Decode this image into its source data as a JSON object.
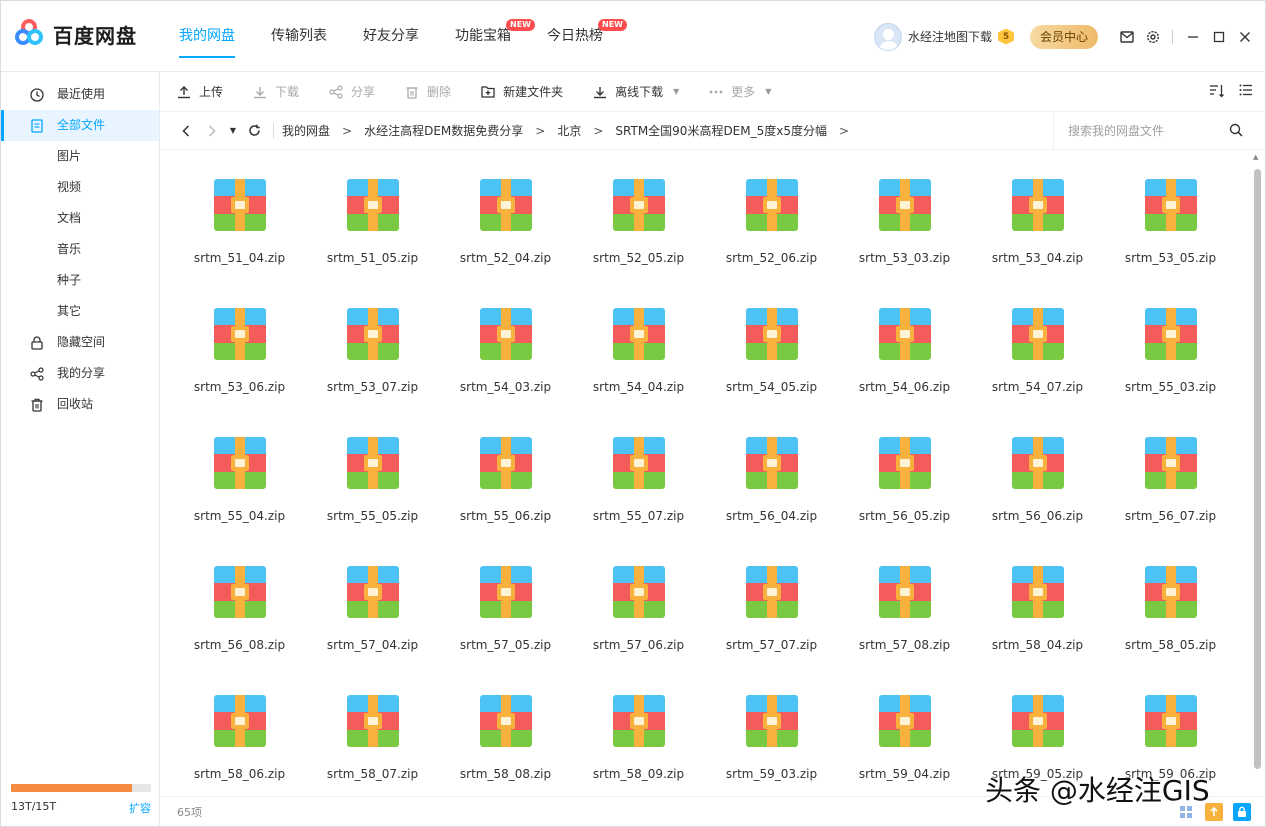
{
  "app": {
    "name": "百度网盘"
  },
  "main_nav": [
    {
      "label": "我的网盘",
      "active": true,
      "badge": ""
    },
    {
      "label": "传输列表",
      "active": false,
      "badge": ""
    },
    {
      "label": "好友分享",
      "active": false,
      "badge": ""
    },
    {
      "label": "功能宝箱",
      "active": false,
      "badge": "NEW"
    },
    {
      "label": "今日热榜",
      "active": false,
      "badge": "NEW"
    }
  ],
  "user": {
    "name": "水经注地图下载",
    "level": "5",
    "vip_label": "会员中心"
  },
  "sidebar": {
    "items": [
      {
        "label": "最近使用",
        "icon": "clock-icon",
        "active": false
      },
      {
        "label": "全部文件",
        "icon": "file-icon",
        "active": true
      },
      {
        "label": "图片",
        "icon": "",
        "active": false
      },
      {
        "label": "视频",
        "icon": "",
        "active": false
      },
      {
        "label": "文档",
        "icon": "",
        "active": false
      },
      {
        "label": "音乐",
        "icon": "",
        "active": false
      },
      {
        "label": "种子",
        "icon": "",
        "active": false
      },
      {
        "label": "其它",
        "icon": "",
        "active": false
      },
      {
        "label": "隐藏空间",
        "icon": "lock-icon",
        "active": false
      },
      {
        "label": "我的分享",
        "icon": "share-icon",
        "active": false
      },
      {
        "label": "回收站",
        "icon": "trash-icon",
        "active": false
      }
    ],
    "storage": {
      "used_label": "13T/15T",
      "used_fraction": 0.867,
      "expand_label": "扩容"
    }
  },
  "toolbar": {
    "upload": "上传",
    "download": "下载",
    "share": "分享",
    "delete": "删除",
    "new_folder": "新建文件夹",
    "offline_download": "离线下载",
    "more": "更多"
  },
  "breadcrumb": [
    "我的网盘",
    "水经注高程DEM数据免费分享",
    "北京",
    "SRTM全国90米高程DEM_5度x5度分幅"
  ],
  "search": {
    "placeholder": "搜索我的网盘文件"
  },
  "files": [
    "srtm_51_04.zip",
    "srtm_51_05.zip",
    "srtm_52_04.zip",
    "srtm_52_05.zip",
    "srtm_52_06.zip",
    "srtm_53_03.zip",
    "srtm_53_04.zip",
    "srtm_53_05.zip",
    "srtm_53_06.zip",
    "srtm_53_07.zip",
    "srtm_54_03.zip",
    "srtm_54_04.zip",
    "srtm_54_05.zip",
    "srtm_54_06.zip",
    "srtm_54_07.zip",
    "srtm_55_03.zip",
    "srtm_55_04.zip",
    "srtm_55_05.zip",
    "srtm_55_06.zip",
    "srtm_55_07.zip",
    "srtm_56_04.zip",
    "srtm_56_05.zip",
    "srtm_56_06.zip",
    "srtm_56_07.zip",
    "srtm_56_08.zip",
    "srtm_57_04.zip",
    "srtm_57_05.zip",
    "srtm_57_06.zip",
    "srtm_57_07.zip",
    "srtm_57_08.zip",
    "srtm_58_04.zip",
    "srtm_58_05.zip",
    "srtm_58_06.zip",
    "srtm_58_07.zip",
    "srtm_58_08.zip",
    "srtm_58_09.zip",
    "srtm_59_03.zip",
    "srtm_59_04.zip",
    "srtm_59_05.zip",
    "srtm_59_06.zip"
  ],
  "status": {
    "count": "65项"
  },
  "watermark": "头条 @水经注GIS",
  "colors": {
    "accent": "#06a7ff",
    "storage": "#f58b3f",
    "badge": "#ff4d4f"
  }
}
